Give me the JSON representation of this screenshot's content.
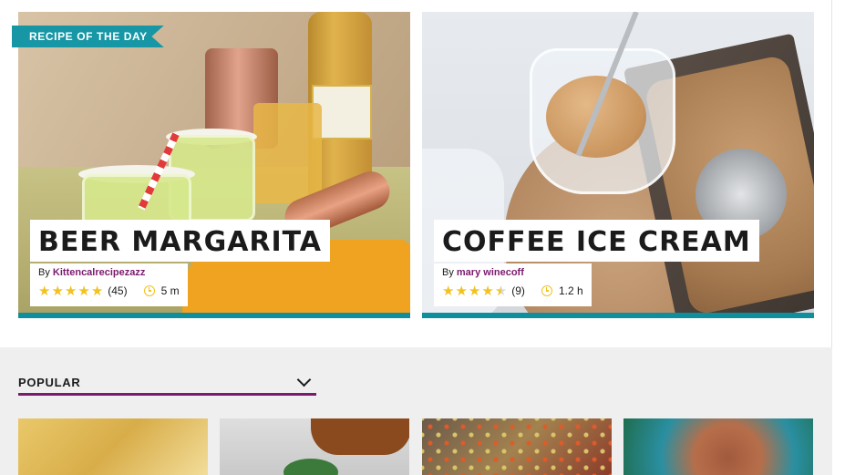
{
  "featured": [
    {
      "badge": "RECIPE OF THE DAY",
      "title": "BEER MARGARITA",
      "by_prefix": "By",
      "author": "Kittencalrecipezazz",
      "rating": 5,
      "reviews": "(45)",
      "time": "5 m"
    },
    {
      "title": "COFFEE ICE CREAM",
      "by_prefix": "By",
      "author": "mary winecoff",
      "rating": 4.5,
      "reviews": "(9)",
      "time": "1.2 h"
    }
  ],
  "filter": {
    "label": "POPULAR",
    "icon": "chevron-down-icon"
  },
  "colors": {
    "accent": "#1797a5",
    "author": "#7b1a6e",
    "star": "#f2c21e",
    "filter_underline": "#7b1a6e"
  }
}
